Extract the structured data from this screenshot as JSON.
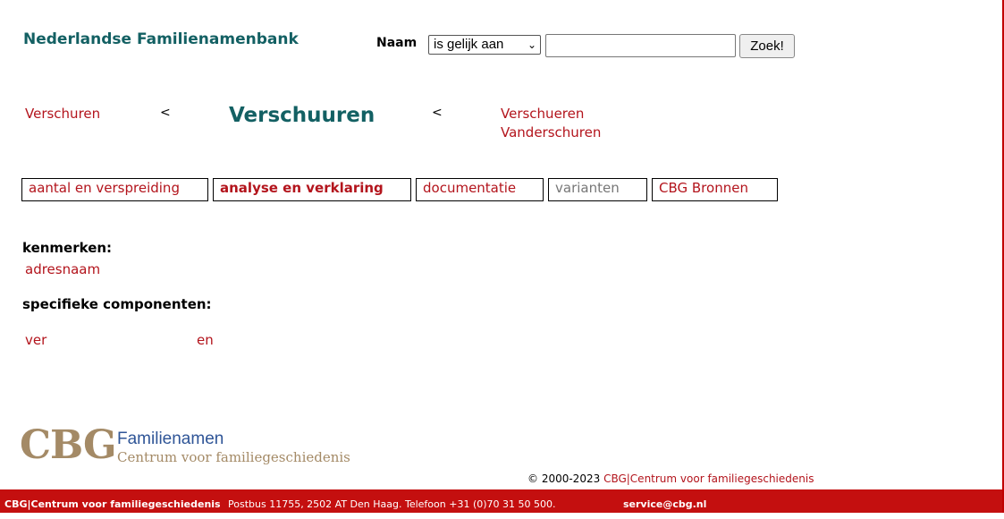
{
  "header": {
    "site_title": "Nederlandse Familienamenbank"
  },
  "search": {
    "label": "Naam",
    "match_mode": "is gelijk aan",
    "query": "",
    "button_label": "Zoek!"
  },
  "name_nav": {
    "previous": "Verschuren",
    "arrow_left": "<",
    "current": "Verschuuren",
    "arrow_right": "<",
    "next": [
      "Verschueren",
      "Vanderschuren"
    ]
  },
  "tabs": [
    {
      "label": "aantal en verspreiding",
      "state": "normal"
    },
    {
      "label": "analyse en verklaring",
      "state": "active"
    },
    {
      "label": "documentatie",
      "state": "normal"
    },
    {
      "label": "varianten",
      "state": "disabled"
    },
    {
      "label": "CBG Bronnen",
      "state": "normal"
    }
  ],
  "content": {
    "kenmerken_heading": "kenmerken:",
    "kenmerken": [
      "adresnaam"
    ],
    "componenten_heading": "specifieke componenten:",
    "componenten": [
      "ver",
      "en"
    ]
  },
  "logo": {
    "mark": "CBG",
    "title": "Familienamen",
    "subtitle": "Centrum voor familiegeschiedenis"
  },
  "copyright": {
    "prefix": "© 2000-2023",
    "link": "CBG|Centrum voor familiegeschiedenis"
  },
  "footer": {
    "org": "CBG|Centrum voor familiegeschiedenis",
    "address": "Postbus 11755, 2502 AT Den Haag. Telefoon +31 (0)70 31 50 500.",
    "email": "service@cbg.nl"
  },
  "colors": {
    "accent_teal": "#136063",
    "link_red": "#b3141c",
    "footer_red": "#c40f0f",
    "logo_tan": "#a48a66"
  }
}
